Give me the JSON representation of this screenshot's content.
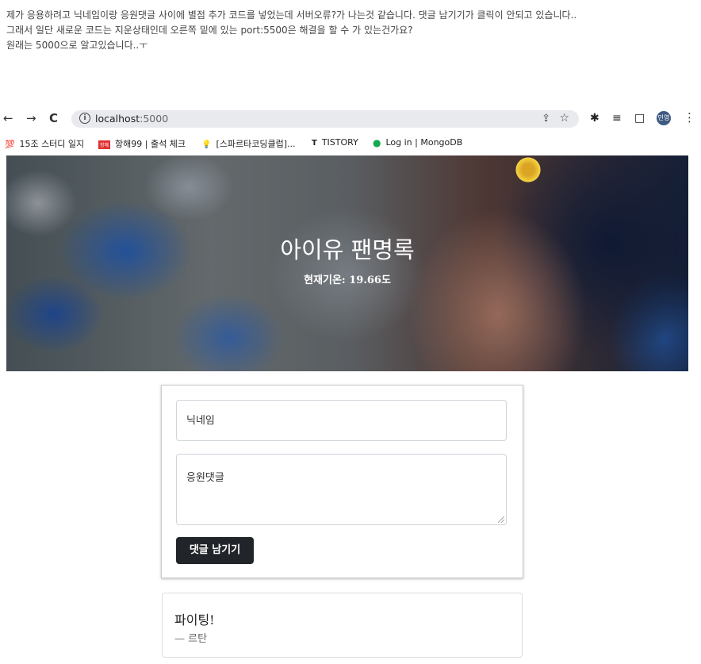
{
  "post": {
    "line1": "제가 응용하려고 닉네임이랑 응원댓글 사이에 별점 추가 코드를 넣었는데 서버오류?가 나는것 같습니다. 댓글 남기기가 클릭이 안되고 있습니다..",
    "line2": "그래서 일단 새로운 코드는 지운상태인데 오른쪽 밑에 있는 port:5500은 해결을 할 수 가 있는건가요?",
    "line3": "원래는 5000으로 알고있습니다..ㅜ"
  },
  "browser": {
    "back": "←",
    "forward": "→",
    "reload": "C",
    "url_host": "localhost",
    "url_port": ":5000",
    "info": "i",
    "share": "⇪",
    "star": "☆",
    "extensions": "✱",
    "reading_list": "≡",
    "side_panel": "□",
    "avatar": "민영",
    "menu": "⋮"
  },
  "bookmarks": [
    {
      "icon": "💯",
      "label": "15조 스터디 일지"
    },
    {
      "icon": "항해",
      "label": "항해99 | 출석 체크"
    },
    {
      "icon": "💡",
      "label": "[스파르타코딩클럽]..."
    },
    {
      "icon": "T",
      "label": "TISTORY"
    },
    {
      "icon": "●",
      "label": "Log in | MongoDB"
    }
  ],
  "hero": {
    "title": "아이유 팬명록",
    "subtitle": "현재기온: 19.66도"
  },
  "form": {
    "nickname_placeholder": "닉네임",
    "comment_placeholder": "응원댓글",
    "submit_label": "댓글 남기기"
  },
  "comments": [
    {
      "text": "파이팅!",
      "author": "— 르탄"
    }
  ]
}
